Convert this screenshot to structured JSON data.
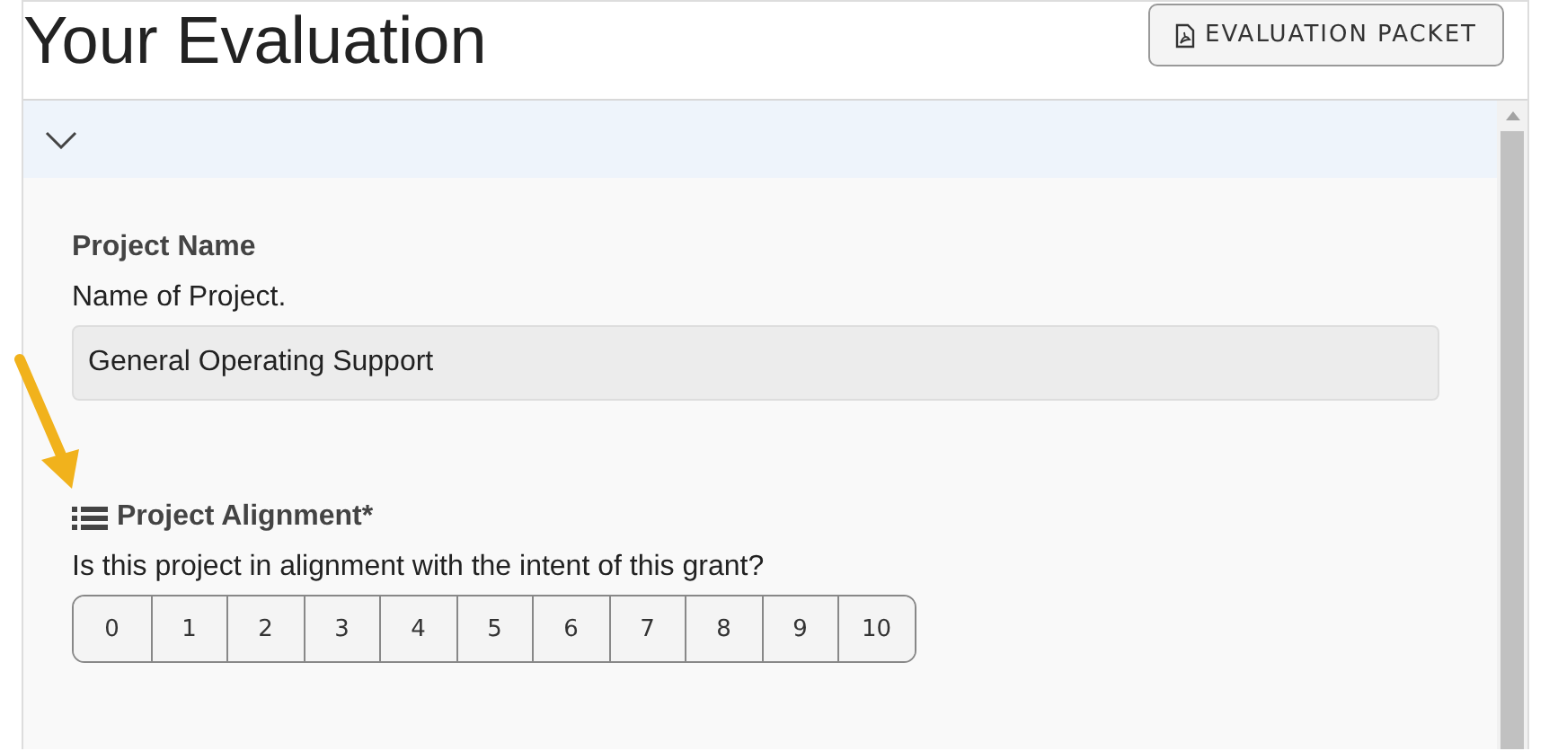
{
  "header": {
    "title": "Your Evaluation",
    "packet_button": "EVALUATION PACKET"
  },
  "section": {
    "expanded": true,
    "fields": [
      {
        "kind": "text",
        "label": "Project Name",
        "description": "Name of Project.",
        "value": "General Operating Support"
      },
      {
        "kind": "rating",
        "label": "Project Alignment*",
        "description": "Is this project in alignment with the intent of this grant?",
        "options": [
          {
            "label": "0",
            "selected": false
          },
          {
            "label": "1",
            "selected": false
          },
          {
            "label": "2",
            "selected": false
          },
          {
            "label": "3",
            "selected": false
          },
          {
            "label": "4",
            "selected": false
          },
          {
            "label": "5",
            "selected": false
          },
          {
            "label": "6",
            "selected": false
          },
          {
            "label": "7",
            "selected": false
          },
          {
            "label": "8",
            "selected": false
          },
          {
            "label": "9",
            "selected": false
          },
          {
            "label": "10",
            "selected": false
          }
        ]
      }
    ]
  }
}
